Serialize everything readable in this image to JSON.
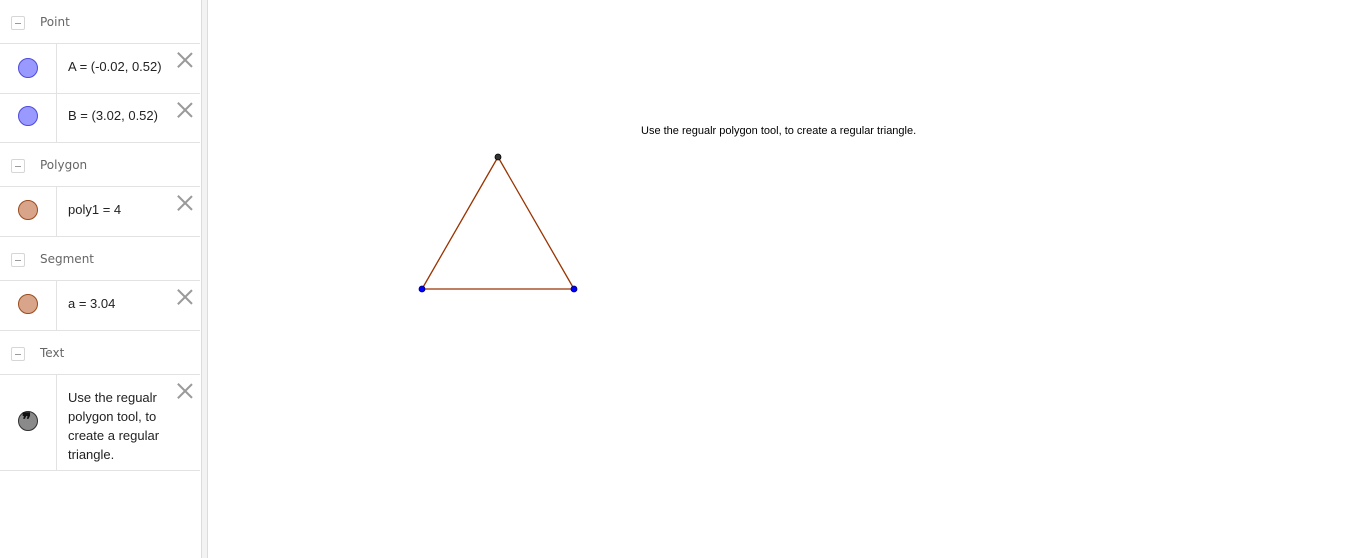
{
  "algebra": {
    "groups": {
      "point": {
        "label": "Point",
        "items": [
          {
            "text": "A = (-0.02, 0.52)"
          },
          {
            "text": "B = (3.02, 0.52)"
          }
        ]
      },
      "polygon": {
        "label": "Polygon",
        "items": [
          {
            "text": "poly1 = 4"
          }
        ]
      },
      "segment": {
        "label": "Segment",
        "items": [
          {
            "text": "a = 3.04"
          }
        ]
      },
      "text": {
        "label": "Text",
        "items": [
          {
            "text": "Use the regualr polygon tool, to create a regular triangle."
          }
        ]
      }
    }
  },
  "graphics": {
    "instruction_text": "Use the regualr polygon tool, to create a regular triangle.",
    "colors": {
      "segment": "#993300",
      "free_point": "#0000ff",
      "dependent_point": "#333333"
    }
  },
  "colors": {
    "point_marble_fill": "#9999ff",
    "shape_marble_fill": "#d9a58a",
    "text_marble_fill": "#8a8a8a"
  }
}
